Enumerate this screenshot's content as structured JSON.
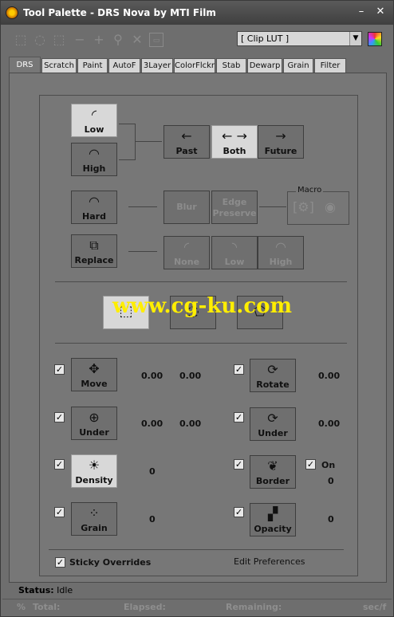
{
  "window": {
    "title": "Tool Palette - DRS Nova by MTI Film",
    "minimize_glyph": "–",
    "close_glyph": "✕"
  },
  "toolbar": {
    "clip_select_value": "[ Clip LUT ]",
    "icons": [
      "select-region-icon",
      "select-lasso-icon",
      "select-multi-icon",
      "minus-icon",
      "plus-icon",
      "wand-icon",
      "delete-icon",
      "image-icon"
    ]
  },
  "tabs": [
    "DRS",
    "Scratch",
    "Paint",
    "AutoF",
    "3Layer",
    "ColorFlckr",
    "Stab",
    "Dewarp",
    "Grain",
    "Filter"
  ],
  "drs": {
    "low": "Low",
    "high": "High",
    "past": "Past",
    "both": "Both",
    "future": "Future",
    "hard": "Hard",
    "blur": "Blur",
    "edge_preserve_1": "Edge",
    "edge_preserve_2": "Preserve",
    "macro": "Macro",
    "replace": "Replace",
    "none": "None",
    "low2": "Low",
    "high2": "High"
  },
  "overrides": {
    "move": "Move",
    "move_x": "0.00",
    "move_y": "0.00",
    "rotate": "Rotate",
    "rotate_val": "0.00",
    "under": "Under",
    "under_x": "0.00",
    "under_y": "0.00",
    "under2": "Under",
    "under2_val": "0.00",
    "density": "Density",
    "density_val": "0",
    "border": "Border",
    "border_on": "On",
    "border_val": "0",
    "grain": "Grain",
    "grain_val": "0",
    "opacity": "Opacity",
    "opacity_val": "0",
    "sticky": "Sticky Overrides",
    "edit_prefs": "Edit Preferences"
  },
  "status": {
    "label": "Status:",
    "value": "Idle",
    "percent": "%",
    "total": "Total:",
    "elapsed": "Elapsed:",
    "remaining": "Remaining:",
    "rate": "sec/f"
  },
  "watermark": "www.cg-ku.com"
}
